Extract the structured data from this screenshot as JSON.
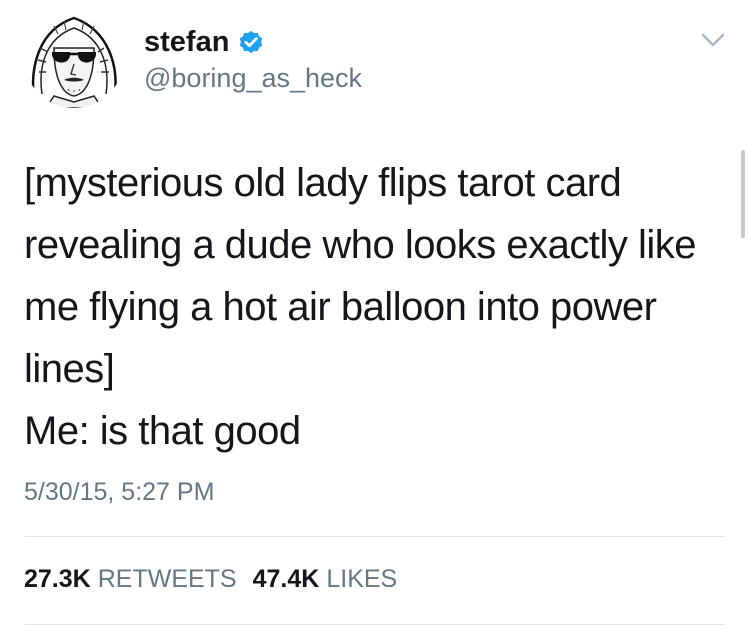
{
  "user": {
    "display_name": "stefan",
    "handle": "@boring_as_heck",
    "verified": true,
    "avatar_icon": "hooded-sunglasses-sketch-avatar"
  },
  "tweet": {
    "lines": [
      "[mysterious old lady flips tarot card",
      "revealing a dude who looks exactly like",
      "me flying a hot air balloon into power",
      "lines]",
      "Me: is that good"
    ],
    "timestamp": "5/30/15, 5:27 PM"
  },
  "stats": {
    "retweets_count": "27.3K",
    "retweets_label": "RETWEETS",
    "likes_count": "47.4K",
    "likes_label": "LIKES"
  },
  "icons": {
    "verified": "verified-badge-icon",
    "more": "chevron-down-icon"
  },
  "colors": {
    "text": "#14171a",
    "secondary": "#657786",
    "verified_blue": "#1da1f2",
    "divider": "#e1e8ed"
  }
}
